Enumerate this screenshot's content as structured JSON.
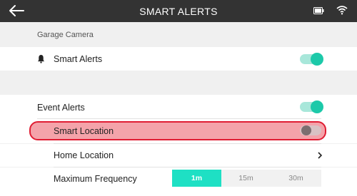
{
  "header": {
    "title": "SMART ALERTS"
  },
  "section": {
    "label": "Garage Camera"
  },
  "smart_alerts": {
    "label": "Smart Alerts",
    "enabled": true
  },
  "event_alerts": {
    "label": "Event Alerts",
    "enabled": true
  },
  "smart_location": {
    "label": "Smart Location",
    "enabled": false
  },
  "home_location": {
    "label": "Home Location"
  },
  "max_frequency": {
    "label": "Maximum Frequency",
    "options": [
      "1m",
      "15m",
      "30m"
    ],
    "selected": "1m"
  },
  "colors": {
    "accent": "#1ee0c4",
    "highlight_border": "#e01d33",
    "header_bg": "#333333"
  }
}
